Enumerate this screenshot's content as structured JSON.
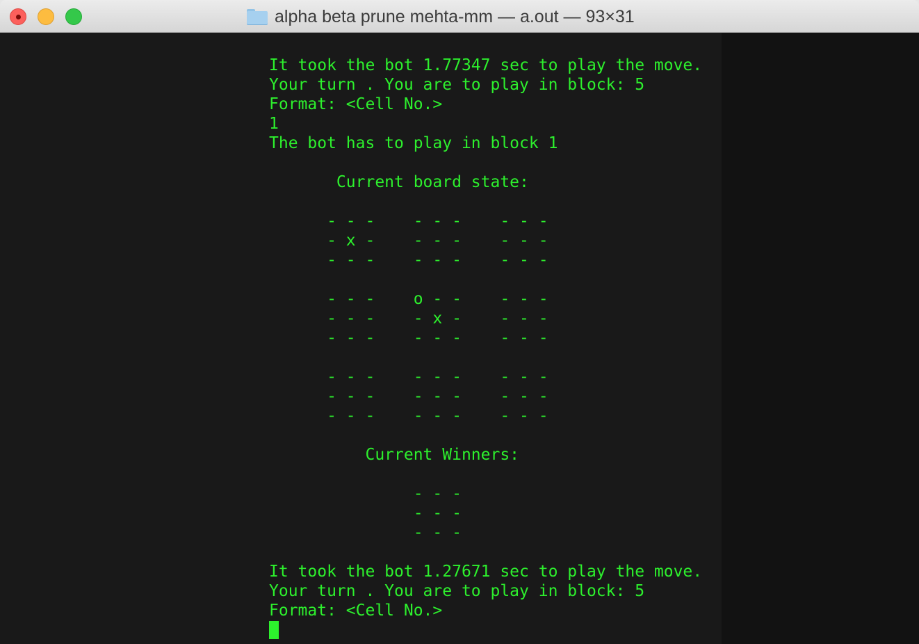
{
  "window": {
    "title": "alpha beta prune mehta-mm — a.out — 93×31",
    "folder_icon": "folder-icon"
  },
  "terminal": {
    "text_color": "#2df02d",
    "background": "#191919",
    "lines": [
      "It took the bot 1.77347 sec to play the move.",
      "Your turn . You are to play in block: 5",
      "Format: <Cell No.>",
      "1",
      "The bot has to play in block 1",
      "",
      "       Current board state:",
      "",
      "      - - -    - - -    - - -",
      "      - x -    - - -    - - -",
      "      - - -    - - -    - - -",
      "",
      "      - - -    o - -    - - -",
      "      - - -    - x -    - - -",
      "      - - -    - - -    - - -",
      "",
      "      - - -    - - -    - - -",
      "      - - -    - - -    - - -",
      "      - - -    - - -    - - -",
      "",
      "          Current Winners:",
      "",
      "               - - -",
      "               - - -",
      "               - - -",
      "",
      "It took the bot 1.27671 sec to play the move.",
      "Your turn . You are to play in block: 5",
      "Format: <Cell No.>"
    ]
  }
}
